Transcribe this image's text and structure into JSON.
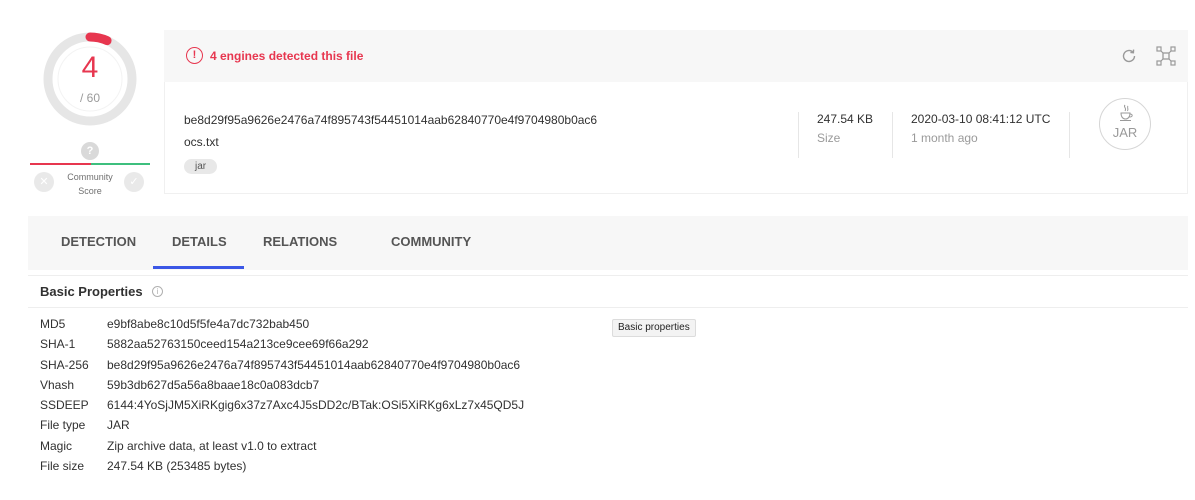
{
  "score": {
    "detections": "4",
    "total": "/ 60",
    "detection_ratio": 0.0667,
    "community": {
      "question_icon": "question-icon",
      "label_line1": "Community",
      "label_line2": "Score"
    }
  },
  "summary": {
    "alert_text": "4 engines detected this file",
    "hash": "be8d29f95a9626e2476a74f895743f54451014aab62840770e4f9704980b0ac6",
    "filename": "ocs.txt",
    "tag": "jar",
    "size_value": "247.54 KB",
    "size_label": "Size",
    "date_value": "2020-03-10 08:41:12 UTC",
    "date_label": "1 month ago",
    "file_type_badge": "JAR"
  },
  "tabs": [
    {
      "label": "DETECTION"
    },
    {
      "label": "DETAILS"
    },
    {
      "label": "RELATIONS"
    },
    {
      "label": "COMMUNITY"
    }
  ],
  "active_tab": "DETAILS",
  "basic": {
    "title": "Basic Properties",
    "tooltip": "Basic properties",
    "rows": [
      {
        "key": "MD5",
        "value": "e9bf8abe8c10d5f5fe4a7dc732bab450"
      },
      {
        "key": "SHA-1",
        "value": "5882aa52763150ceed154a213ce9cee69f66a292"
      },
      {
        "key": "SHA-256",
        "value": "be8d29f95a9626e2476a74f895743f54451014aab62840770e4f9704980b0ac6"
      },
      {
        "key": "Vhash",
        "value": "59b3db627d5a56a8baae18c0a083dcb7"
      },
      {
        "key": "SSDEEP",
        "value": "6144:4YoSjJM5XiRKgig6x37z7Axc4J5sDD2c/BTak:OSi5XiRKg6xLz7x45QD5J"
      },
      {
        "key": "File type",
        "value": "JAR"
      },
      {
        "key": "Magic",
        "value": "Zip archive data, at least v1.0 to extract"
      },
      {
        "key": "File size",
        "value": "247.54 KB (253485 bytes)"
      }
    ]
  },
  "colors": {
    "danger": "#e7364f",
    "ok": "#3ebf7e",
    "active_tab": "#3b57e6"
  }
}
